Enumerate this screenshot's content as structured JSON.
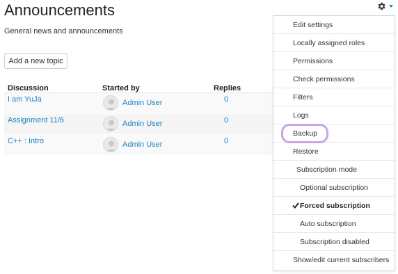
{
  "page": {
    "title": "Announcements",
    "intro": "General news and announcements",
    "add_button": "Add a new topic"
  },
  "table": {
    "headers": {
      "discussion": "Discussion",
      "started_by": "Started by",
      "replies": "Replies"
    },
    "rows": [
      {
        "topic": "I am YuJa",
        "author": "Admin User",
        "replies": "0"
      },
      {
        "topic": "Assignment 11/6",
        "author": "Admin User",
        "replies": "0"
      },
      {
        "topic": "C++ : Intro",
        "author": "Admin User",
        "replies": "0"
      }
    ]
  },
  "settings_menu": {
    "icon": "gear-icon",
    "items": [
      {
        "label": "Edit settings"
      },
      {
        "label": "Locally assigned roles"
      },
      {
        "label": "Permissions"
      },
      {
        "label": "Check permissions"
      },
      {
        "label": "Filters"
      },
      {
        "label": "Logs"
      },
      {
        "label": "Backup",
        "highlighted": true
      },
      {
        "label": "Restore"
      },
      {
        "label": "Subscription mode"
      },
      {
        "label": "Optional subscription"
      },
      {
        "label": "Forced subscription",
        "selected": true
      },
      {
        "label": "Auto subscription"
      },
      {
        "label": "Subscription disabled"
      },
      {
        "label": "Show/edit current subscribers"
      }
    ]
  },
  "colors": {
    "link": "#1a84c3",
    "highlight_ring": "#c7a6e6"
  }
}
